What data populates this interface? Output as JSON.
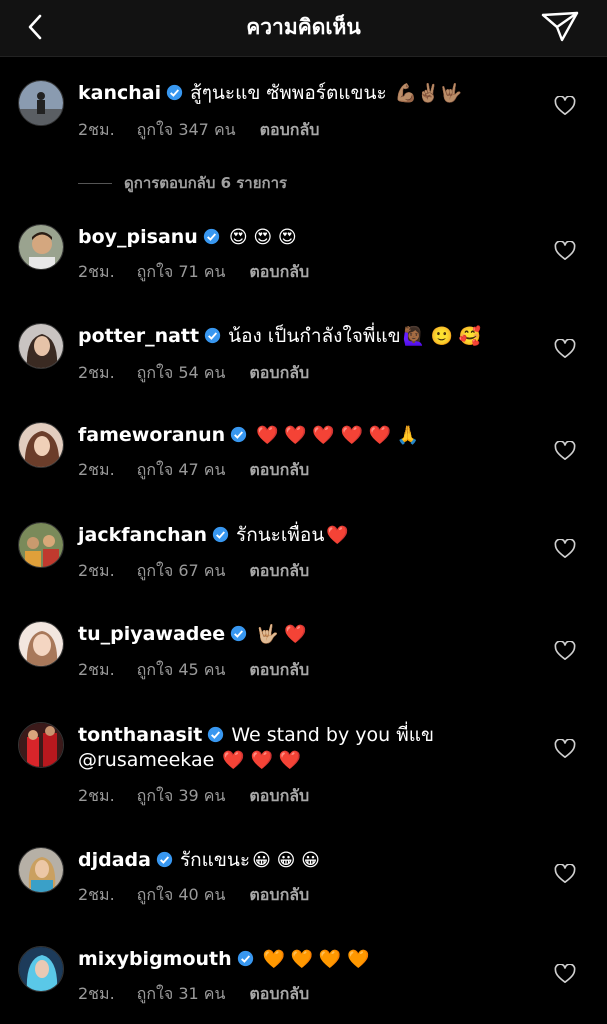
{
  "header": {
    "title": "ความคิดเห็น"
  },
  "view_replies": "ดูการตอบกลับ 6 รายการ",
  "comments": [
    {
      "username": "kanchai",
      "text": "สู้ๆนะแข ซัพพอร์ตแขนะ",
      "emoji": "💪🏽✌🏽🤟🏽",
      "time": "2ชม.",
      "likes": "ถูกใจ 347 คน",
      "reply": "ตอบกลับ"
    },
    {
      "username": "boy_pisanu",
      "text": "",
      "emoji": "😍 😍 😍",
      "time": "2ชม.",
      "likes": "ถูกใจ 71 คน",
      "reply": "ตอบกลับ"
    },
    {
      "username": "potter_natt",
      "text": "น้อง เป็นกำลังใจพี่แข",
      "emoji": "🙋🏾‍♀️ 🙂 🥰",
      "time": "2ชม.",
      "likes": "ถูกใจ 54 คน",
      "reply": "ตอบกลับ"
    },
    {
      "username": "fameworanun",
      "text": "",
      "emoji": "❤️ ❤️ ❤️ ❤️ ❤️ 🙏",
      "time": "2ชม.",
      "likes": "ถูกใจ 47 คน",
      "reply": "ตอบกลับ"
    },
    {
      "username": "jackfanchan",
      "text": "รักนะเพื่อน",
      "emoji": "❤️",
      "time": "2ชม.",
      "likes": "ถูกใจ 67 คน",
      "reply": "ตอบกลับ"
    },
    {
      "username": "tu_piyawadee",
      "text": "",
      "emoji": "🤟🏼 ❤️",
      "time": "2ชม.",
      "likes": "ถูกใจ 45 คน",
      "reply": "ตอบกลับ"
    },
    {
      "username": "tonthanasit",
      "text": "We stand by you พี่แข",
      "text2": "@rusameekae",
      "emoji": "❤️ ❤️ ❤️",
      "time": "2ชม.",
      "likes": "ถูกใจ 39 คน",
      "reply": "ตอบกลับ"
    },
    {
      "username": "djdada",
      "text": "รักแขนะ",
      "emoji": "😀 😀 😀",
      "time": "2ชม.",
      "likes": "ถูกใจ 40 คน",
      "reply": "ตอบกลับ"
    },
    {
      "username": "mixybigmouth",
      "text": "",
      "emoji": "🧡 🧡 🧡 🧡",
      "time": "2ชม.",
      "likes": "ถูกใจ 31 คน",
      "reply": "ตอบกลับ"
    }
  ],
  "colors": {
    "background": "#000000",
    "header": "#121212",
    "verified": "#3897f0",
    "meta": "#9a9a9a"
  }
}
